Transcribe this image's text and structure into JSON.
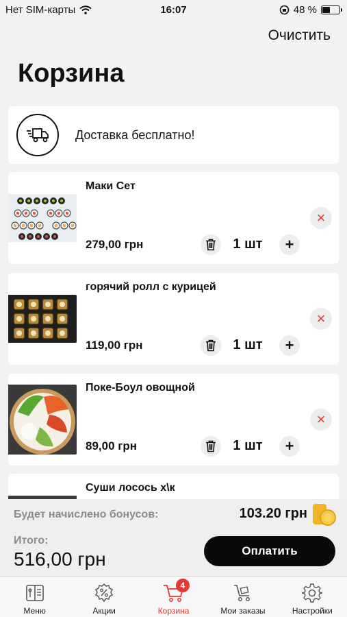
{
  "status_bar": {
    "carrier": "Нет SIM-карты",
    "time": "16:07",
    "battery_text": "48 %",
    "battery_level": 0.48
  },
  "header": {
    "clear_label": "Очистить",
    "title": "Корзина"
  },
  "delivery": {
    "text": "Доставка бесплатно!",
    "icon": "delivery-truck-icon"
  },
  "cart_items": [
    {
      "name": "Маки Сет",
      "price": "279,00 грн",
      "qty": "1 шт"
    },
    {
      "name": "горячий ролл с курицей",
      "price": "119,00 грн",
      "qty": "1 шт"
    },
    {
      "name": "Поке-Боул овощной",
      "price": "89,00 грн",
      "qty": "1 шт"
    },
    {
      "name": "Суши лосось х\\к"
    }
  ],
  "footer": {
    "bonus_label": "Будет начислено бонусов:",
    "bonus_value": "103.20 грн",
    "total_label": "Итого:",
    "total_value": "516,00 грн",
    "pay_label": "Оплатить"
  },
  "tabs": [
    {
      "label": "Меню",
      "icon": "menu-book-icon"
    },
    {
      "label": "Акции",
      "icon": "discount-icon"
    },
    {
      "label": "Корзина",
      "icon": "cart-icon",
      "badge": "4",
      "active": true
    },
    {
      "label": "Мои заказы",
      "icon": "orders-cart-icon"
    },
    {
      "label": "Настройки",
      "icon": "gear-icon"
    }
  ],
  "colors": {
    "accent": "#e53935",
    "button": "#0a0a0a",
    "background": "#f2f2f2"
  }
}
